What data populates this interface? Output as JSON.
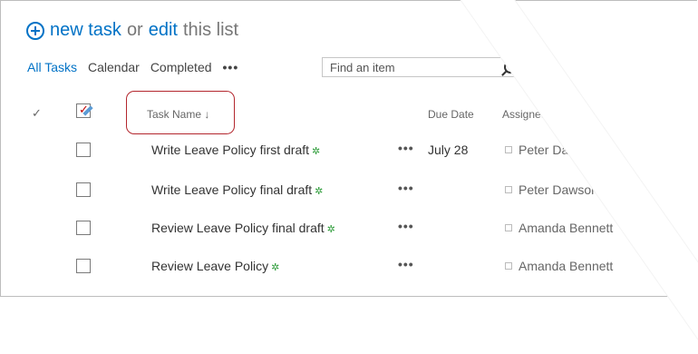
{
  "header": {
    "new_label": "new task",
    "or_label": "or",
    "edit_label": "edit",
    "this_list_label": "this list"
  },
  "views": {
    "items": [
      {
        "label": "All Tasks",
        "active": true
      },
      {
        "label": "Calendar",
        "active": false
      },
      {
        "label": "Completed",
        "active": false
      }
    ],
    "more_label": "•••"
  },
  "search": {
    "placeholder": "Find an item"
  },
  "columns": {
    "check": "✓",
    "task_name": "Task Name ↓",
    "due_date": "Due Date",
    "assigned_to": "Assigned To"
  },
  "rows": [
    {
      "title": "Write Leave Policy first draft",
      "new_badge": "✲",
      "more": "•••",
      "due": "July 28",
      "assigned": "Peter Dawson"
    },
    {
      "title": "Write Leave Policy final draft",
      "new_badge": "✲",
      "more": "•••",
      "due": "",
      "assigned": "Peter Dawson"
    },
    {
      "title": "Review Leave Policy final draft",
      "new_badge": "✲",
      "more": "•••",
      "due": "",
      "assigned": "Amanda Bennett"
    },
    {
      "title": "Review Leave Policy",
      "new_badge": "✲",
      "more": "•••",
      "due": "",
      "assigned": "Amanda Bennett"
    }
  ],
  "colors": {
    "accent": "#0072c6",
    "highlight": "#b3262d",
    "new_badge": "#2e9c3a"
  }
}
